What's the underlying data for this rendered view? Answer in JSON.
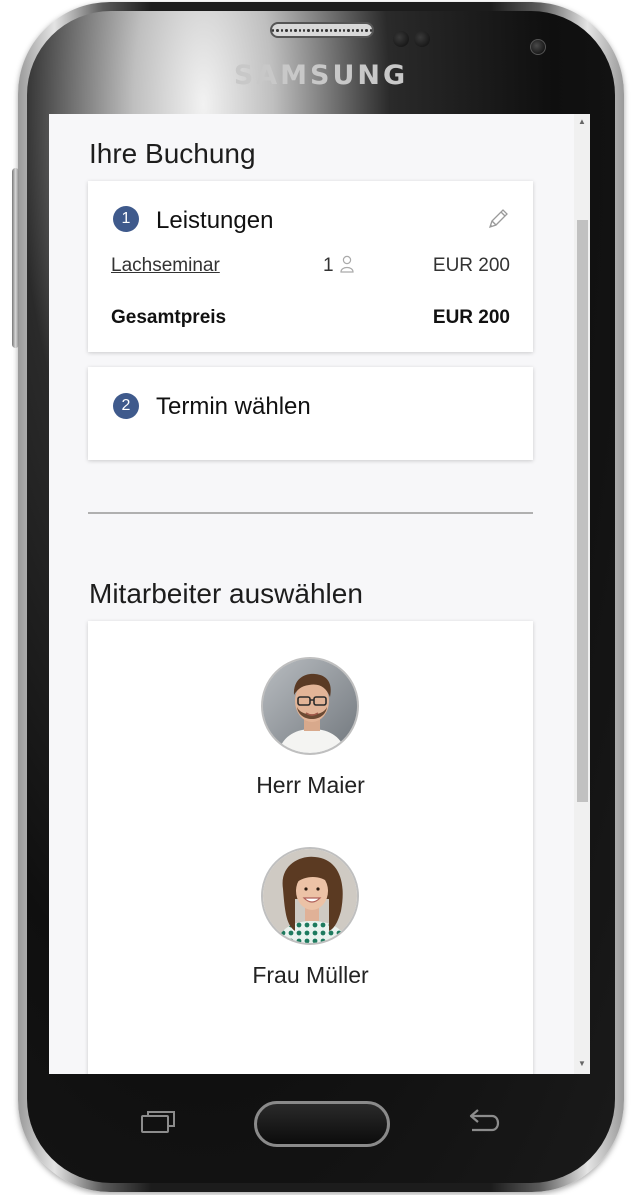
{
  "device": {
    "brand": "SAMSUNG"
  },
  "booking": {
    "title": "Ihre Buchung",
    "step1": {
      "number": "1",
      "title": "Leistungen",
      "service_name": "Lachseminar",
      "quantity": "1",
      "service_price": "EUR 200",
      "total_label": "Gesamtpreis",
      "total_price": "EUR 200"
    },
    "step2": {
      "number": "2",
      "title": "Termin wählen"
    }
  },
  "staff": {
    "title": "Mitarbeiter auswählen",
    "members": [
      {
        "name": "Herr Maier"
      },
      {
        "name": "Frau Müller"
      }
    ]
  },
  "colors": {
    "accent": "#3f5a8c",
    "background": "#f7f7f9"
  }
}
